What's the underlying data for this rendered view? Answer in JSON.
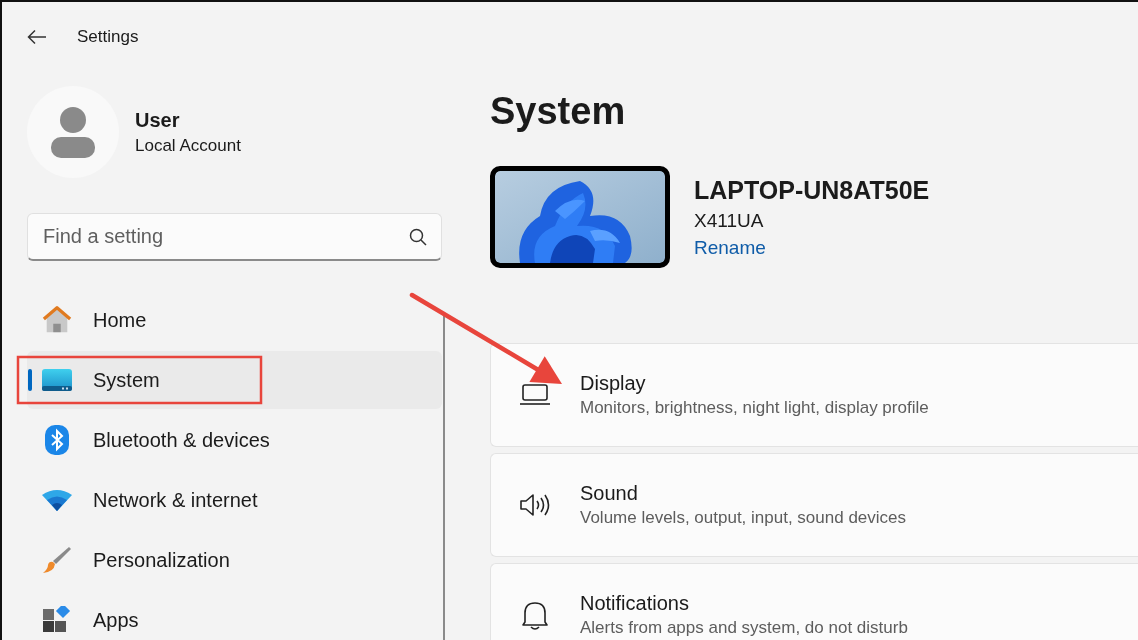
{
  "window": {
    "title": "Settings"
  },
  "account": {
    "name": "User",
    "type": "Local Account"
  },
  "search": {
    "placeholder": "Find a setting"
  },
  "nav_items": [
    {
      "label": "Home",
      "selected": false
    },
    {
      "label": "System",
      "selected": true
    },
    {
      "label": "Bluetooth & devices",
      "selected": false
    },
    {
      "label": "Network & internet",
      "selected": false
    },
    {
      "label": "Personalization",
      "selected": false
    },
    {
      "label": "Apps",
      "selected": false
    }
  ],
  "page_title": "System",
  "device": {
    "name": "LAPTOP-UN8AT50E",
    "model": "X411UA",
    "link": "Rename"
  },
  "cards": [
    {
      "title": "Display",
      "description": "Monitors, brightness, night light, display profile"
    },
    {
      "title": "Sound",
      "description": "Volume levels, output, input, sound devices"
    },
    {
      "title": "Notifications",
      "description": "Alerts from apps and system, do not disturb"
    }
  ],
  "annotations": [
    {
      "kind": "box"
    },
    {
      "kind": "arrow"
    }
  ]
}
